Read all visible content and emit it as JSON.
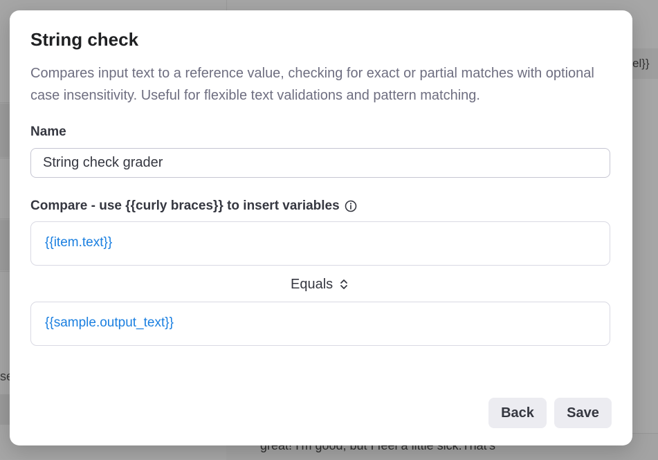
{
  "background": {
    "left_cut_text": "se",
    "right_variable_text": "el}}",
    "bottom_text": "great! I'm good, but I feel a little sick.That's"
  },
  "modal": {
    "title": "String check",
    "description": "Compares input text to a reference value, checking for exact or partial matches with optional case insensitivity. Useful for flexible text validations and pattern matching.",
    "name_label": "Name",
    "name_value": "String check grader",
    "compare_label": "Compare - use {{curly braces}} to insert variables",
    "input_variable": "{{item.text}}",
    "operator": "Equals",
    "reference_variable": "{{sample.output_text}}",
    "back_label": "Back",
    "save_label": "Save"
  },
  "icons": {
    "info": "info-icon",
    "operator_toggle": "chevrons-up-down-icon"
  },
  "colors": {
    "variable_text": "#1a7fe0",
    "button_bg": "#ececf1",
    "title_text": "#202123",
    "muted_text": "#6e6e80"
  }
}
